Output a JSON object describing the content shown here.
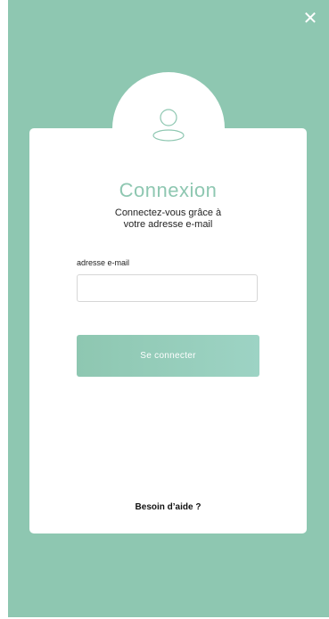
{
  "header": {
    "close_icon": "close-icon"
  },
  "avatar": {
    "icon": "user-icon"
  },
  "login": {
    "title": "Connexion",
    "subtitle": "Connectez-vous grâce à\nvotre adresse e-mail",
    "email_label": "adresse e-mail",
    "email_value": "",
    "email_placeholder": "",
    "submit_label": "Se connecter",
    "help_link": "Besoin d’aide ?"
  },
  "colors": {
    "background": "#8ec7b1",
    "accent": "#8ec7b1",
    "card": "#ffffff"
  }
}
